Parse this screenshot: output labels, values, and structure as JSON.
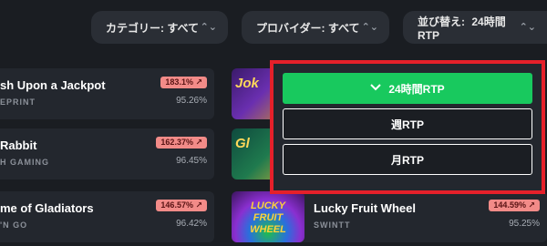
{
  "filters": {
    "category": {
      "label": "カテゴリー: すべて"
    },
    "provider": {
      "label": "プロバイダー: すべて"
    },
    "sort": {
      "prefix": "並び替え:",
      "value": "24時間RTP"
    }
  },
  "games_left": [
    {
      "title": "sh Upon a Jackpot",
      "provider": "EPRINT",
      "rtp_change": "183.1% ↗",
      "rtp": "95.26%"
    },
    {
      "title": "Rabbit",
      "provider": "H GAMING",
      "rtp_change": "162.37% ↗",
      "rtp": "96.45%"
    },
    {
      "title": "me of Gladiators",
      "provider": "'N GO",
      "rtp_change": "146.57% ↗",
      "rtp": "96.42%"
    }
  ],
  "games_right": [
    {
      "title": "Lucky Fruit Wheel",
      "provider": "SWINTT",
      "rtp_change": "144.59% ↗",
      "rtp": "95.25%",
      "thumb_text": "LUCKY FRUIT WHEEL"
    }
  ],
  "thumbs": {
    "t1": "Jok",
    "t2": "Gl"
  },
  "sort_options": [
    {
      "label": "24時間RTP",
      "selected": true
    },
    {
      "label": "週RTP",
      "selected": false
    },
    {
      "label": "月RTP",
      "selected": false
    }
  ],
  "colors": {
    "accent_green": "#18c95e",
    "highlight_red": "#e5202a",
    "badge_pink": "#f28b88"
  },
  "icons": {
    "pill_chevron": "chevron-up-down-icon",
    "selected_check": "chevron-down-icon"
  }
}
